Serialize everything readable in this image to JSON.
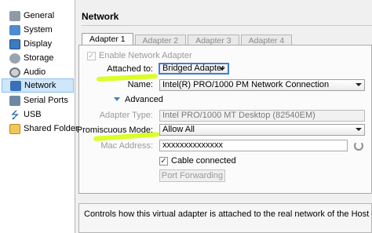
{
  "sidebar": {
    "items": [
      {
        "label": "General",
        "icon": "general-icon"
      },
      {
        "label": "System",
        "icon": "system-icon"
      },
      {
        "label": "Display",
        "icon": "display-icon"
      },
      {
        "label": "Storage",
        "icon": "storage-icon"
      },
      {
        "label": "Audio",
        "icon": "audio-icon"
      },
      {
        "label": "Network",
        "icon": "network-icon",
        "selected": true
      },
      {
        "label": "Serial Ports",
        "icon": "serial-ports-icon"
      },
      {
        "label": "USB",
        "icon": "usb-icon"
      },
      {
        "label": "Shared Folders",
        "icon": "shared-folders-icon"
      }
    ],
    "usb_glyph": "⭍"
  },
  "page": {
    "title": "Network"
  },
  "tabs": [
    {
      "label": "Adapter 1",
      "active": true
    },
    {
      "label": "Adapter 2"
    },
    {
      "label": "Adapter 3"
    },
    {
      "label": "Adapter 4"
    }
  ],
  "form": {
    "enable_label": "Enable Network Adapter",
    "enable_checked": true,
    "attached_label": "Attached to:",
    "attached_value": "Bridged Adapter",
    "name_label": "Name:",
    "name_value": "Intel(R) PRO/1000 PM Network Connection",
    "advanced_label": "Advanced",
    "adapter_type_label": "Adapter Type:",
    "adapter_type_value": "Intel PRO/1000 MT Desktop (82540EM)",
    "promiscuous_label": "Promiscuous Mode:",
    "promiscuous_value": "Allow All",
    "mac_label": "Mac Address:",
    "mac_value": "xxxxxxxxxxxxxx",
    "cable_label": "Cable connected",
    "cable_checked": true,
    "check_glyph": "✓",
    "port_forwarding_label": "Port Forwarding"
  },
  "description": "Controls how this virtual adapter is attached to the real network of the Host OS.",
  "colors": {
    "selection": "#cfe6fb",
    "focus_border": "#3f7fd0",
    "highlighter": "#d2ff00"
  }
}
